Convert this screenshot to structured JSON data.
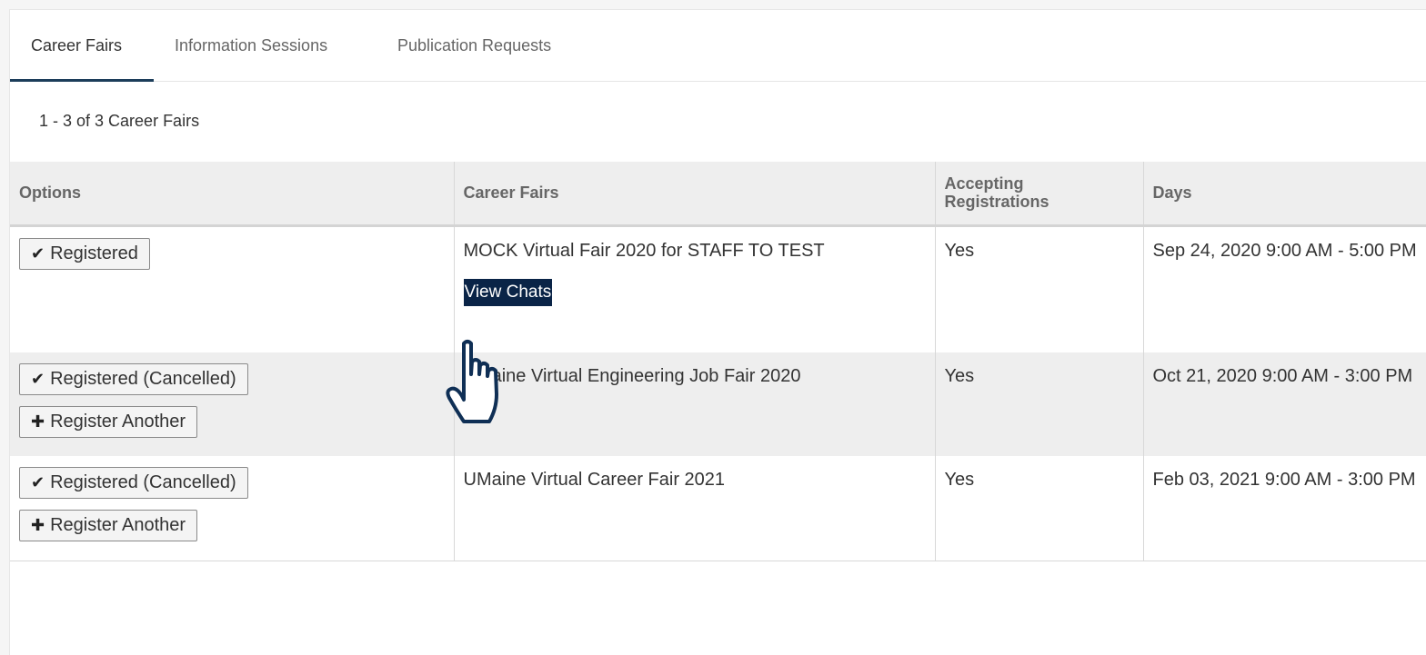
{
  "tabs": [
    {
      "label": "Career Fairs",
      "active": true
    },
    {
      "label": "Information Sessions",
      "active": false
    },
    {
      "label": "Publication Requests",
      "active": false
    }
  ],
  "count_text": "1 - 3 of 3 Career Fairs",
  "columns": {
    "options": "Options",
    "career_fairs": "Career Fairs",
    "accepting_line1": "Accepting",
    "accepting_line2": "Registrations",
    "days": "Days"
  },
  "rows": [
    {
      "status_button": "Registered",
      "fair": "MOCK Virtual Fair 2020 for STAFF TO TEST",
      "link": "View Chats",
      "accepting": "Yes",
      "days": "Sep 24, 2020 9:00 AM - 5:00 PM"
    },
    {
      "status_button": "Registered (Cancelled)",
      "another_button": "Register Another",
      "fair": "UMaine Virtual Engineering Job Fair 2020",
      "accepting": "Yes",
      "days": "Oct 21, 2020 9:00 AM - 3:00 PM"
    },
    {
      "status_button": "Registered (Cancelled)",
      "another_button": "Register Another",
      "fair": "UMaine Virtual Career Fair 2021",
      "accepting": "Yes",
      "days": "Feb 03, 2021 9:00 AM - 3:00 PM"
    }
  ],
  "icons": {
    "check": "check-icon",
    "plus": "plus-icon",
    "cursor": "hand-pointer-icon"
  },
  "colors": {
    "tab_active_underline": "#1c3d5a",
    "highlight_bg": "#0a2447",
    "cursor_stroke": "#0f2f55"
  }
}
